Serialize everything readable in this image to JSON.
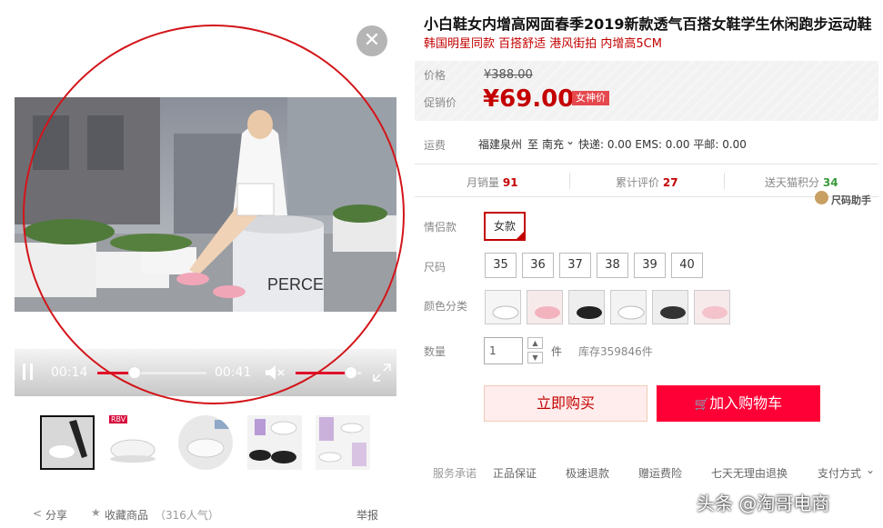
{
  "video": {
    "time_current": "00:14",
    "time_total": "00:41",
    "progress": 0.34,
    "volume": 0.85,
    "close_icon": "close-icon",
    "play_icon": "pause-icon",
    "volume_icon": "mute-icon",
    "fullscreen_icon": "fullscreen-icon",
    "drum_text": "PERCE"
  },
  "thumbs": [
    {
      "name": "thumb-1",
      "badge": ""
    },
    {
      "name": "thumb-2",
      "badge": "RBV"
    },
    {
      "name": "thumb-3",
      "badge": ""
    },
    {
      "name": "thumb-4",
      "badge": ""
    },
    {
      "name": "thumb-5",
      "badge": ""
    }
  ],
  "footer": {
    "share": "分享",
    "favorite": "收藏商品",
    "popularity": "（316人气）",
    "report": "举报"
  },
  "product": {
    "title": "小白鞋女内增高网面春季2019新款透气百搭女鞋学生休闲跑步运动鞋",
    "subtitle": "韩国明星同款 百搭舒适 港风街拍 内增高5CM"
  },
  "price": {
    "label": "价格",
    "original": "¥388.00",
    "promo_label": "促销价",
    "promo_value": "¥69.00",
    "promo_tag": "女神价"
  },
  "shipping": {
    "label": "运费",
    "from": "福建泉州",
    "to_word": "至",
    "to": "南充",
    "detail": "快递: 0.00 EMS: 0.00 平邮: 0.00"
  },
  "stats": {
    "sales_label": "月销量",
    "sales": "91",
    "reviews_label": "累计评价",
    "reviews": "27",
    "points_label": "送天猫积分",
    "points": "34",
    "size_helper": "尺码助手"
  },
  "couple": {
    "label": "情侣款",
    "option": "女款"
  },
  "sizes": {
    "label": "尺码",
    "options": [
      "35",
      "36",
      "37",
      "38",
      "39",
      "40"
    ]
  },
  "colors": {
    "label": "颜色分类"
  },
  "quantity": {
    "label": "数量",
    "value": "1",
    "unit": "件",
    "stock": "库存359846件"
  },
  "actions": {
    "buy": "立即购买",
    "cart": "加入购物车"
  },
  "services": {
    "label": "服务承诺",
    "items": [
      "正品保证",
      "极速退款",
      "赠运费险",
      "七天无理由退换"
    ],
    "pay": "支付方式"
  },
  "watermark": "头条 @淘哥电商"
}
